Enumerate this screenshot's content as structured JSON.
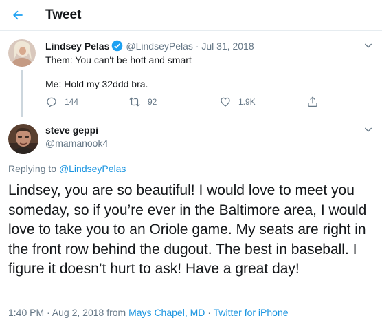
{
  "header": {
    "title": "Tweet",
    "back_icon": "arrow-left-icon"
  },
  "colors": {
    "accent": "#1da1f2",
    "link": "#1b95e0",
    "secondary_text": "#657786",
    "border": "#e6ecf0"
  },
  "parent_tweet": {
    "name": "Lindsey Pelas",
    "verified": true,
    "handle_date": "@LindseyPelas · Jul 31, 2018",
    "line1": "Them: You can't be hott and smart",
    "line2": "Me: Hold my 32ddd bra.",
    "reply_count": "144",
    "retweet_count": "92",
    "like_count": "1.9K",
    "icons": [
      "reply-icon",
      "retweet-icon",
      "like-icon",
      "share-icon"
    ]
  },
  "reply_tweet": {
    "name": "steve geppi",
    "handle": "@mamanook4",
    "replying_prefix": "Replying to",
    "replying_mention": "@LindseyPelas",
    "body": "Lindsey, you are so beautiful! I would love to meet you someday, so if you’re ever in the Baltimore area, I would love to take you to an Oriole game. My seats are right in the front row behind the dugout. The best in baseball. I figure it doesn’t hurt to ask! Have a great day!",
    "timestamp": "1:40 PM · Aug 2, 2018 from",
    "location": "Mays Chapel, MD",
    "separator": "·",
    "source": "Twitter for iPhone"
  }
}
